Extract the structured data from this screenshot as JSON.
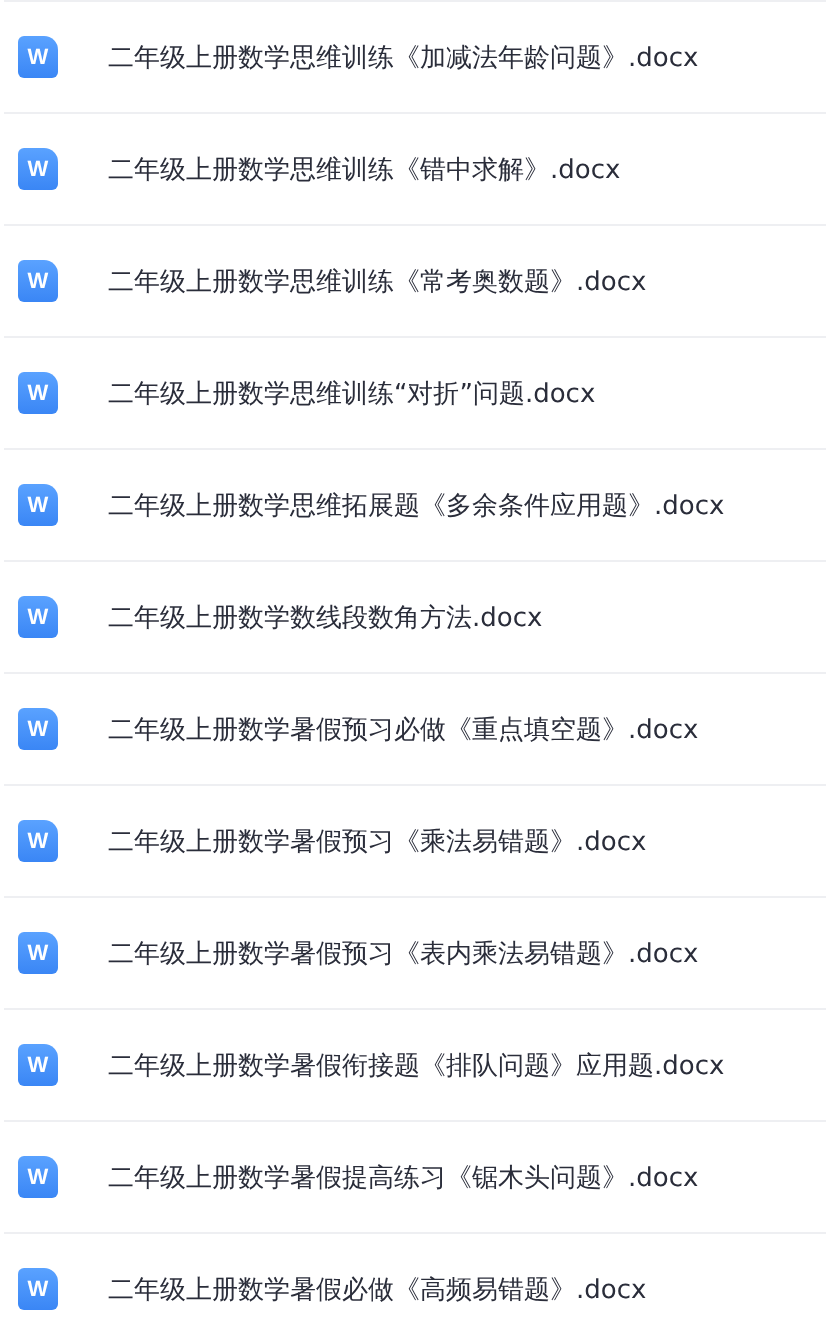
{
  "files": [
    {
      "icon": "W",
      "name": "二年级上册数学思维训练《加减法年龄问题》.docx"
    },
    {
      "icon": "W",
      "name": "二年级上册数学思维训练《错中求解》.docx"
    },
    {
      "icon": "W",
      "name": "二年级上册数学思维训练《常考奥数题》.docx"
    },
    {
      "icon": "W",
      "name": "二年级上册数学思维训练“对折”问题.docx"
    },
    {
      "icon": "W",
      "name": "二年级上册数学思维拓展题《多余条件应用题》.docx"
    },
    {
      "icon": "W",
      "name": "二年级上册数学数线段数角方法.docx"
    },
    {
      "icon": "W",
      "name": "二年级上册数学暑假预习必做《重点填空题》.docx"
    },
    {
      "icon": "W",
      "name": "二年级上册数学暑假预习《乘法易错题》.docx"
    },
    {
      "icon": "W",
      "name": "二年级上册数学暑假预习《表内乘法易错题》.docx"
    },
    {
      "icon": "W",
      "name": "二年级上册数学暑假衔接题《排队问题》应用题.docx"
    },
    {
      "icon": "W",
      "name": "二年级上册数学暑假提高练习《锯木头问题》.docx"
    },
    {
      "icon": "W",
      "name": "二年级上册数学暑假必做《高频易错题》.docx"
    }
  ]
}
